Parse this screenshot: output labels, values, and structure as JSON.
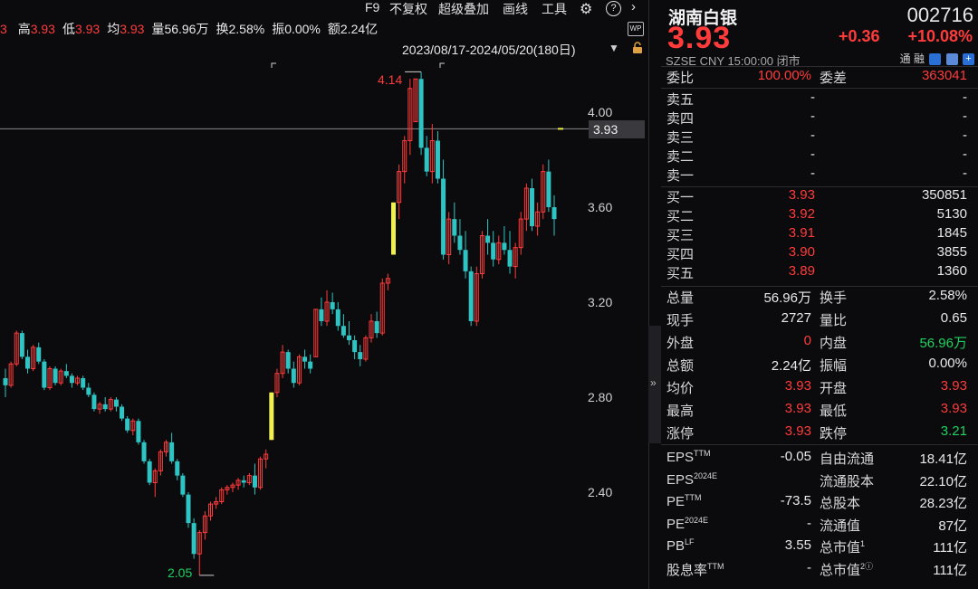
{
  "toolbar": {
    "f9": "F9",
    "adjust": "不复权",
    "overlay": "超级叠加",
    "draw": "画线",
    "tools": "工具"
  },
  "stats": [
    {
      "label": "高",
      "value": "3.93",
      "color": "red"
    },
    {
      "label": "低",
      "value": "3.93",
      "color": "red"
    },
    {
      "label": "均",
      "value": "3.93",
      "color": "red"
    },
    {
      "label": "量",
      "value": "56.96万",
      "color": "white"
    },
    {
      "label": "换",
      "value": "2.58%",
      "color": "white"
    },
    {
      "label": "振",
      "value": "0.00%",
      "color": "white"
    },
    {
      "label": "额",
      "value": "2.24亿",
      "color": "white"
    }
  ],
  "stats_prefix": "3",
  "range": "2023/08/17-2024/05/20(180日)",
  "wp_label": "WP",
  "price_tag": "3.93",
  "y_ticks": [
    "4.00",
    "3.60",
    "3.20",
    "2.80",
    "2.40"
  ],
  "high_label": "4.14",
  "low_label": "2.05",
  "colors": {
    "up": "#ff3b3b",
    "down": "#2ec4c4",
    "limit": "#f0f050",
    "green": "#20d060"
  },
  "quote": {
    "name": "湖南白银",
    "code": "002716",
    "price": "3.93",
    "change": "+0.36",
    "pct": "+10.08%",
    "exchange": "SZSE",
    "currency": "CNY",
    "time": "15:00:00",
    "status": "闭市",
    "tong": "通",
    "rong": "融",
    "ratio_label": "委比",
    "ratio_value": "100.00%",
    "diff_label": "委差",
    "diff_value": "363041",
    "asks": [
      {
        "label": "卖五",
        "price": "-",
        "qty": "-"
      },
      {
        "label": "卖四",
        "price": "-",
        "qty": "-"
      },
      {
        "label": "卖三",
        "price": "-",
        "qty": "-"
      },
      {
        "label": "卖二",
        "price": "-",
        "qty": "-"
      },
      {
        "label": "卖一",
        "price": "-",
        "qty": "-"
      }
    ],
    "bids": [
      {
        "label": "买一",
        "price": "3.93",
        "qty": "350851"
      },
      {
        "label": "买二",
        "price": "3.92",
        "qty": "5130"
      },
      {
        "label": "买三",
        "price": "3.91",
        "qty": "1845"
      },
      {
        "label": "买四",
        "price": "3.90",
        "qty": "3855"
      },
      {
        "label": "买五",
        "price": "3.89",
        "qty": "1360"
      }
    ],
    "stats": [
      {
        "l1": "总量",
        "v1": "56.96万",
        "c1": "white",
        "l2": "换手",
        "v2": "2.58%",
        "c2": "white"
      },
      {
        "l1": "现手",
        "v1": "2727",
        "c1": "white",
        "l2": "量比",
        "v2": "0.65",
        "c2": "white"
      },
      {
        "l1": "外盘",
        "v1": "0",
        "c1": "red",
        "l2": "内盘",
        "v2": "56.96万",
        "c2": "green"
      },
      {
        "l1": "总额",
        "v1": "2.24亿",
        "c1": "white",
        "l2": "振幅",
        "v2": "0.00%",
        "c2": "white"
      },
      {
        "l1": "均价",
        "v1": "3.93",
        "c1": "red",
        "l2": "开盘",
        "v2": "3.93",
        "c2": "red"
      },
      {
        "l1": "最高",
        "v1": "3.93",
        "c1": "red",
        "l2": "最低",
        "v2": "3.93",
        "c2": "red"
      },
      {
        "l1": "涨停",
        "v1": "3.93",
        "c1": "red",
        "l2": "跌停",
        "v2": "3.21",
        "c2": "green"
      }
    ],
    "fund": [
      {
        "l1": "EPS",
        "s1": "TTM",
        "v1": "-0.05",
        "l2": "自由流通",
        "s2": "",
        "v2": "18.41亿"
      },
      {
        "l1": "EPS",
        "s1": "2024E",
        "v1": "",
        "l2": "流通股本",
        "s2": "",
        "v2": "22.10亿"
      },
      {
        "l1": "PE",
        "s1": "TTM",
        "v1": "-73.5",
        "l2": "总股本",
        "s2": "",
        "v2": "28.23亿"
      },
      {
        "l1": "PE",
        "s1": "2024E",
        "v1": "-",
        "l2": "流通值",
        "s2": "",
        "v2": "87亿"
      },
      {
        "l1": "PB",
        "s1": "LF",
        "v1": "3.55",
        "l2": "总市值",
        "s2": "1",
        "v2": "111亿"
      },
      {
        "l1": "股息率",
        "s1": "TTM",
        "v1": "-",
        "l2": "总市值",
        "s2": "2ⓘ",
        "v2": "111亿"
      }
    ]
  },
  "chart_data": {
    "type": "candlestick",
    "ylim": [
      2.0,
      4.25
    ],
    "y_ticks": [
      4.0,
      3.6,
      3.2,
      2.8,
      2.4
    ],
    "last_price": 3.93,
    "high": 4.14,
    "low": 2.05,
    "candles": [
      [
        2.88,
        2.92,
        2.8,
        2.85
      ],
      [
        2.85,
        2.95,
        2.84,
        2.94
      ],
      [
        2.94,
        3.08,
        2.93,
        3.07
      ],
      [
        3.07,
        3.08,
        2.96,
        2.97
      ],
      [
        2.97,
        3.0,
        2.9,
        2.92
      ],
      [
        2.92,
        3.02,
        2.91,
        3.01
      ],
      [
        3.01,
        3.03,
        2.94,
        2.95
      ],
      [
        2.95,
        2.96,
        2.83,
        2.84
      ],
      [
        2.84,
        2.93,
        2.83,
        2.92
      ],
      [
        2.92,
        2.93,
        2.85,
        2.86
      ],
      [
        2.86,
        2.92,
        2.85,
        2.91
      ],
      [
        2.91,
        2.94,
        2.88,
        2.89
      ],
      [
        2.89,
        2.9,
        2.84,
        2.86
      ],
      [
        2.86,
        2.89,
        2.85,
        2.88
      ],
      [
        2.88,
        2.89,
        2.83,
        2.84
      ],
      [
        2.84,
        2.86,
        2.8,
        2.81
      ],
      [
        2.81,
        2.82,
        2.74,
        2.75
      ],
      [
        2.75,
        2.78,
        2.73,
        2.77
      ],
      [
        2.77,
        2.8,
        2.74,
        2.75
      ],
      [
        2.75,
        2.8,
        2.74,
        2.79
      ],
      [
        2.79,
        2.8,
        2.74,
        2.76
      ],
      [
        2.76,
        2.77,
        2.7,
        2.71
      ],
      [
        2.71,
        2.72,
        2.65,
        2.66
      ],
      [
        2.66,
        2.71,
        2.64,
        2.7
      ],
      [
        2.7,
        2.71,
        2.6,
        2.61
      ],
      [
        2.61,
        2.62,
        2.52,
        2.53
      ],
      [
        2.53,
        2.54,
        2.43,
        2.44
      ],
      [
        2.44,
        2.5,
        2.38,
        2.49
      ],
      [
        2.49,
        2.58,
        2.47,
        2.57
      ],
      [
        2.57,
        2.62,
        2.55,
        2.61
      ],
      [
        2.61,
        2.65,
        2.52,
        2.53
      ],
      [
        2.53,
        2.54,
        2.45,
        2.47
      ],
      [
        2.47,
        2.48,
        2.38,
        2.39
      ],
      [
        2.39,
        2.4,
        2.25,
        2.27
      ],
      [
        2.27,
        2.29,
        2.12,
        2.14
      ],
      [
        2.14,
        2.24,
        2.05,
        2.23
      ],
      [
        2.23,
        2.32,
        2.2,
        2.3
      ],
      [
        2.3,
        2.36,
        2.28,
        2.35
      ],
      [
        2.35,
        2.38,
        2.33,
        2.36
      ],
      [
        2.36,
        2.42,
        2.35,
        2.41
      ],
      [
        2.41,
        2.43,
        2.39,
        2.42
      ],
      [
        2.42,
        2.44,
        2.4,
        2.43
      ],
      [
        2.43,
        2.46,
        2.41,
        2.45
      ],
      [
        2.45,
        2.47,
        2.42,
        2.44
      ],
      [
        2.44,
        2.48,
        2.43,
        2.47
      ],
      [
        2.47,
        2.52,
        2.39,
        2.42
      ],
      [
        2.42,
        2.55,
        2.41,
        2.54
      ],
      [
        2.54,
        2.58,
        2.5,
        2.56
      ],
      [
        2.62,
        2.82,
        2.62,
        2.82
      ],
      [
        2.82,
        2.92,
        2.8,
        2.9
      ],
      [
        2.9,
        3.02,
        2.88,
        2.99
      ],
      [
        2.99,
        3.0,
        2.9,
        2.92
      ],
      [
        2.92,
        2.95,
        2.84,
        2.86
      ],
      [
        2.86,
        2.98,
        2.85,
        2.97
      ],
      [
        2.97,
        3.0,
        2.92,
        2.95
      ],
      [
        2.95,
        2.98,
        2.9,
        2.92
      ],
      [
        2.97,
        3.17,
        2.97,
        3.17
      ],
      [
        3.17,
        3.22,
        3.1,
        3.12
      ],
      [
        3.12,
        3.25,
        3.1,
        3.2
      ],
      [
        3.2,
        3.24,
        3.15,
        3.17
      ],
      [
        3.17,
        3.2,
        3.08,
        3.1
      ],
      [
        3.1,
        3.15,
        3.05,
        3.06
      ],
      [
        3.06,
        3.12,
        3.02,
        3.04
      ],
      [
        3.04,
        3.06,
        2.96,
        2.99
      ],
      [
        2.99,
        3.02,
        2.93,
        2.96
      ],
      [
        2.96,
        3.06,
        2.95,
        3.05
      ],
      [
        3.05,
        3.15,
        3.03,
        3.12
      ],
      [
        3.12,
        3.16,
        3.05,
        3.07
      ],
      [
        3.07,
        3.3,
        3.06,
        3.28
      ],
      [
        3.28,
        3.32,
        3.25,
        3.3
      ],
      [
        3.4,
        3.62,
        3.4,
        3.62
      ],
      [
        3.62,
        3.78,
        3.55,
        3.75
      ],
      [
        3.75,
        3.9,
        3.7,
        3.88
      ],
      [
        3.88,
        4.14,
        3.82,
        4.1
      ],
      [
        3.96,
        4.14,
        3.96,
        4.14
      ],
      [
        4.14,
        4.17,
        3.82,
        3.85
      ],
      [
        3.85,
        3.9,
        3.73,
        3.75
      ],
      [
        3.75,
        3.95,
        3.7,
        3.88
      ],
      [
        3.88,
        3.92,
        3.7,
        3.72
      ],
      [
        3.72,
        3.8,
        3.38,
        3.4
      ],
      [
        3.4,
        3.58,
        3.36,
        3.55
      ],
      [
        3.55,
        3.62,
        3.45,
        3.48
      ],
      [
        3.48,
        3.55,
        3.4,
        3.42
      ],
      [
        3.42,
        3.5,
        3.3,
        3.33
      ],
      [
        3.33,
        3.35,
        3.1,
        3.12
      ],
      [
        3.12,
        3.35,
        3.1,
        3.32
      ],
      [
        3.32,
        3.5,
        3.3,
        3.48
      ],
      [
        3.48,
        3.55,
        3.4,
        3.45
      ],
      [
        3.45,
        3.5,
        3.35,
        3.38
      ],
      [
        3.38,
        3.48,
        3.36,
        3.45
      ],
      [
        3.45,
        3.52,
        3.4,
        3.42
      ],
      [
        3.42,
        3.5,
        3.32,
        3.35
      ],
      [
        3.35,
        3.45,
        3.3,
        3.43
      ],
      [
        3.43,
        3.58,
        3.4,
        3.55
      ],
      [
        3.55,
        3.7,
        3.5,
        3.68
      ],
      [
        3.68,
        3.72,
        3.5,
        3.52
      ],
      [
        3.52,
        3.62,
        3.48,
        3.58
      ],
      [
        3.58,
        3.78,
        3.55,
        3.75
      ],
      [
        3.75,
        3.8,
        3.58,
        3.6
      ],
      [
        3.6,
        3.65,
        3.48,
        3.55
      ]
    ]
  }
}
